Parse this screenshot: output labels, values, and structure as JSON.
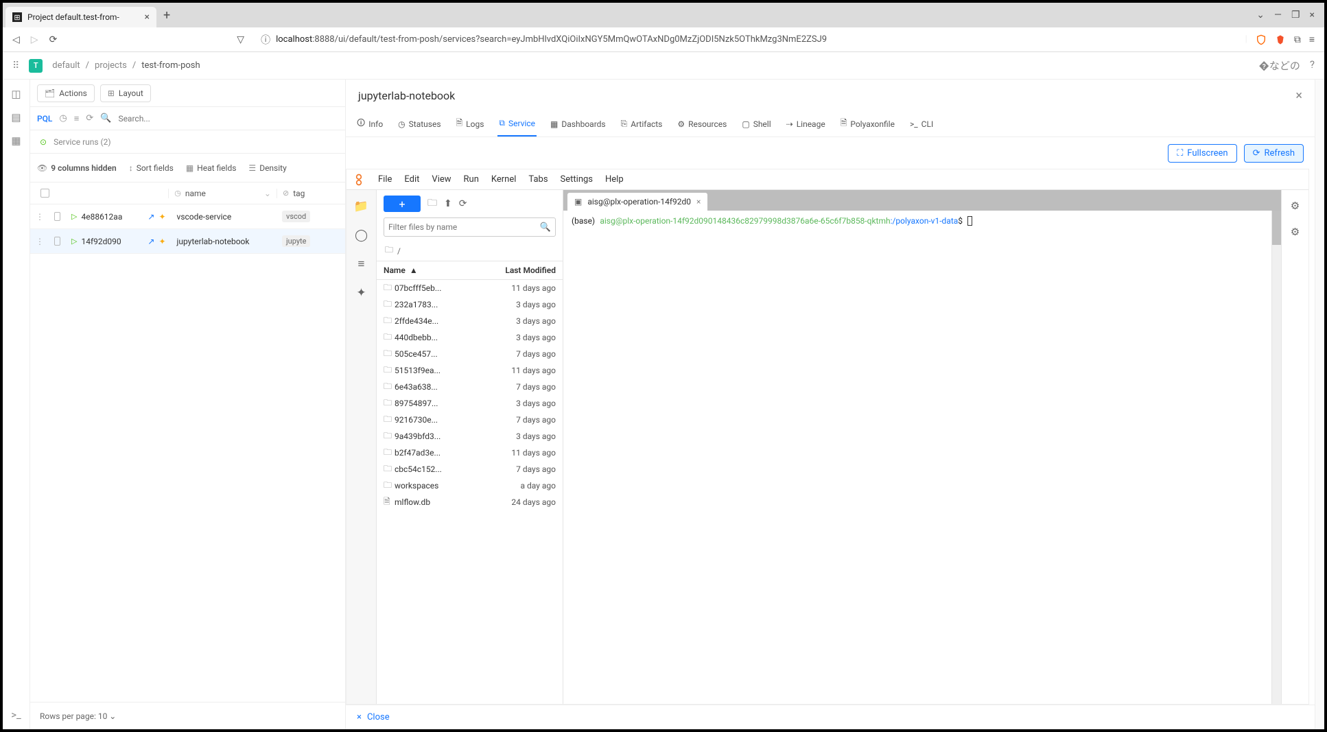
{
  "browser": {
    "tab_title": "Project default.test-from-",
    "url_host": "localhost",
    "url_path": ":8888/ui/default/test-from-posh/services?search=eyJmbHlvdXQiOiIxNGY5MmQwOTAxNDg0MzZjODI5Nzk5OThkMzg3NmE2ZSJ9"
  },
  "app": {
    "org_letter": "T",
    "breadcrumbs": [
      "default",
      "projects",
      "test-from-posh"
    ]
  },
  "panel": {
    "actions_label": "Actions",
    "layout_label": "Layout",
    "pql": "PQL",
    "search_placeholder": "Search...",
    "runs_label": "Service runs (2)",
    "columns_hidden": "9 columns hidden",
    "sort_label": "Sort fields",
    "heat_label": "Heat fields",
    "density_label": "Density",
    "table": {
      "name_header": "name",
      "tags_header": "tag",
      "rows": [
        {
          "id": "4e88612aa",
          "name": "vscode-service",
          "tag": "vscod"
        },
        {
          "id": "14f92d090",
          "name": "jupyterlab-notebook",
          "tag": "jupyte"
        }
      ]
    },
    "pager": "Rows per page: 10"
  },
  "detail": {
    "title": "jupyterlab-notebook",
    "tabs": [
      "Info",
      "Statuses",
      "Logs",
      "Service",
      "Dashboards",
      "Artifacts",
      "Resources",
      "Shell",
      "Lineage",
      "Polyaxonfile",
      "CLI"
    ],
    "active_tab": "Service",
    "fullscreen": "Fullscreen",
    "refresh": "Refresh",
    "close": "Close"
  },
  "jupyter": {
    "menus": [
      "File",
      "Edit",
      "View",
      "Run",
      "Kernel",
      "Tabs",
      "Settings",
      "Help"
    ],
    "filter_placeholder": "Filter files by name",
    "path": "/",
    "col_name": "Name",
    "col_mod": "Last Modified",
    "files": [
      {
        "type": "dir",
        "name": "07bcfff5eb...",
        "mod": "11 days ago"
      },
      {
        "type": "dir",
        "name": "232a1783...",
        "mod": "3 days ago"
      },
      {
        "type": "dir",
        "name": "2ffde434e...",
        "mod": "3 days ago"
      },
      {
        "type": "dir",
        "name": "440dbebb...",
        "mod": "3 days ago"
      },
      {
        "type": "dir",
        "name": "505ce457...",
        "mod": "7 days ago"
      },
      {
        "type": "dir",
        "name": "51513f9ea...",
        "mod": "11 days ago"
      },
      {
        "type": "dir",
        "name": "6e43a638...",
        "mod": "7 days ago"
      },
      {
        "type": "dir",
        "name": "89754897...",
        "mod": "3 days ago"
      },
      {
        "type": "dir",
        "name": "9216730e...",
        "mod": "7 days ago"
      },
      {
        "type": "dir",
        "name": "9a439bfd3...",
        "mod": "3 days ago"
      },
      {
        "type": "dir",
        "name": "b2f47ad3e...",
        "mod": "11 days ago"
      },
      {
        "type": "dir",
        "name": "cbc54c152...",
        "mod": "7 days ago"
      },
      {
        "type": "dir",
        "name": "workspaces",
        "mod": "a day ago"
      },
      {
        "type": "file",
        "name": "mlflow.db",
        "mod": "24 days ago"
      }
    ],
    "terminal": {
      "tab_label": "aisg@plx-operation-14f92d0",
      "base": "(base)",
      "userhost": "aisg@plx-operation-14f92d090148436c82979998d3876a6e-65c6f7b858-qktmh",
      "path": "/polyaxon-v1-data",
      "prompt": "$"
    }
  }
}
